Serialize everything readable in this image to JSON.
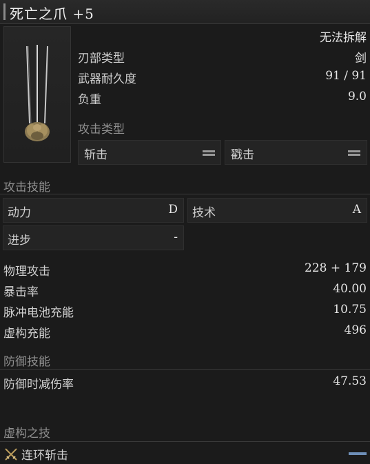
{
  "header": {
    "title": "死亡之爪 +5"
  },
  "item": {
    "dismantle_label": "无法拆解",
    "blade_type_label": "刃部类型",
    "blade_type_value": "剑",
    "durability_label": "武器耐久度",
    "durability_value": "91 / 91",
    "weight_label": "负重",
    "weight_value": "9.0",
    "attack_type_heading": "攻击类型",
    "attack_types": [
      {
        "label": "斩击",
        "icon": "equal-icon"
      },
      {
        "label": "戳击",
        "icon": "equal-icon"
      }
    ]
  },
  "attack_skills": {
    "heading": "攻击技能",
    "motivity_label": "动力",
    "motivity_grade": "D",
    "technique_label": "技术",
    "technique_grade": "A",
    "advance_label": "进步",
    "advance_grade": "-"
  },
  "stats": {
    "physical_attack_label": "物理攻击",
    "physical_attack_value": "228 + 179",
    "crit_label": "暴击率",
    "crit_value": "40.00",
    "pulse_label": "脉冲电池充能",
    "pulse_value": "10.75",
    "fable_label": "虚构充能",
    "fable_value": "496"
  },
  "defense": {
    "heading": "防御技能",
    "guard_label": "防御时减伤率",
    "guard_value": "47.53"
  },
  "fable_arts": {
    "heading": "虚构之技",
    "skill_label": "连环斩击",
    "skill_icon": "crossed-blades-icon",
    "accent_color": "#6e8fb8"
  }
}
